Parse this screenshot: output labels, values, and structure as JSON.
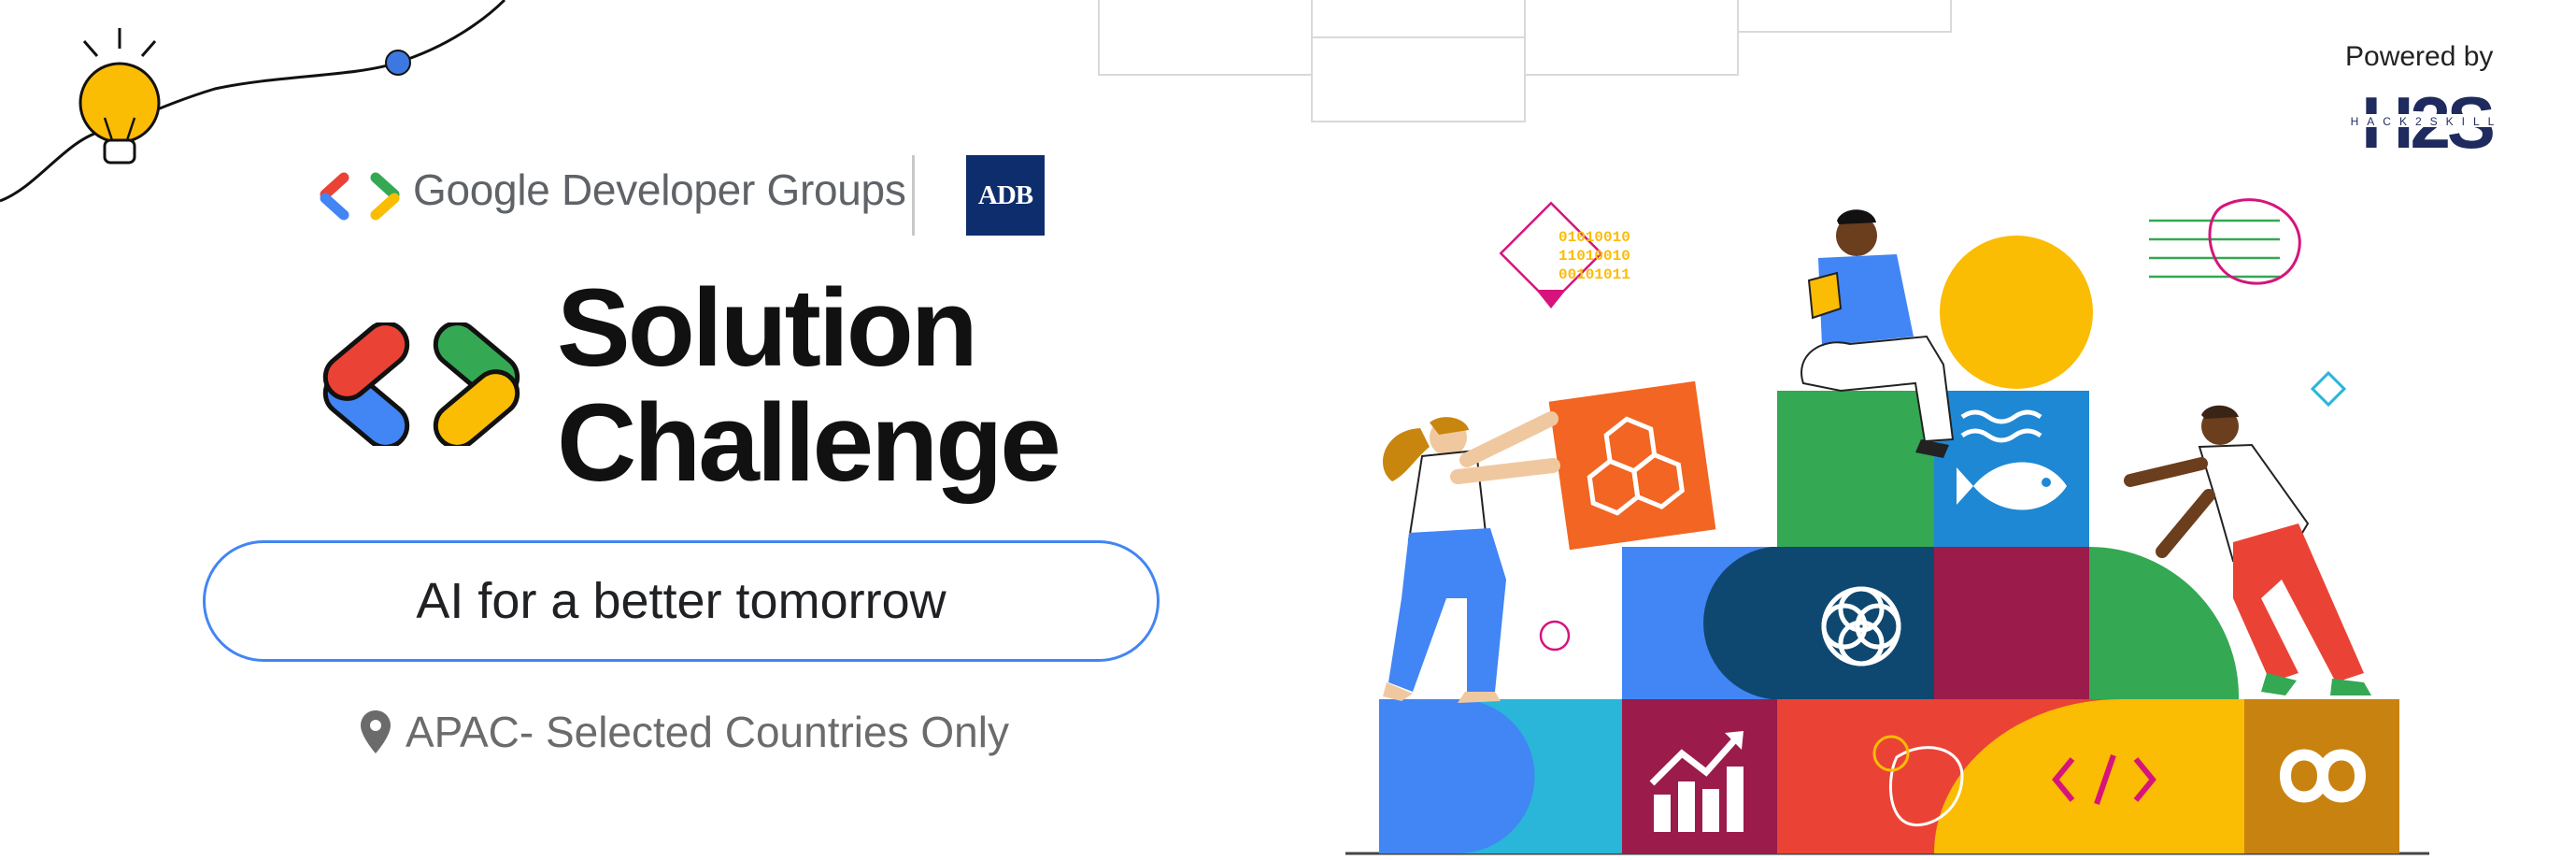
{
  "header": {
    "org_name": "Google Developer Groups",
    "partner_logo_text": "ADB"
  },
  "title": {
    "line1": "Solution",
    "line2": "Challenge"
  },
  "theme": "AI for a better tomorrow",
  "location": "APAC- Selected Countries Only",
  "powered_by": {
    "label": "Powered by",
    "brand": "H2S",
    "brand_sub": "HACK2SKILL"
  },
  "illustration": {
    "binary_lines": [
      "01010010",
      "11010010",
      "00101011"
    ]
  },
  "colors": {
    "google_blue": "#4285f4",
    "google_red": "#ea4335",
    "google_yellow": "#fbbc04",
    "google_green": "#34a853",
    "adb_navy": "#0d2d6c",
    "h2s_navy": "#1f2a5e"
  }
}
